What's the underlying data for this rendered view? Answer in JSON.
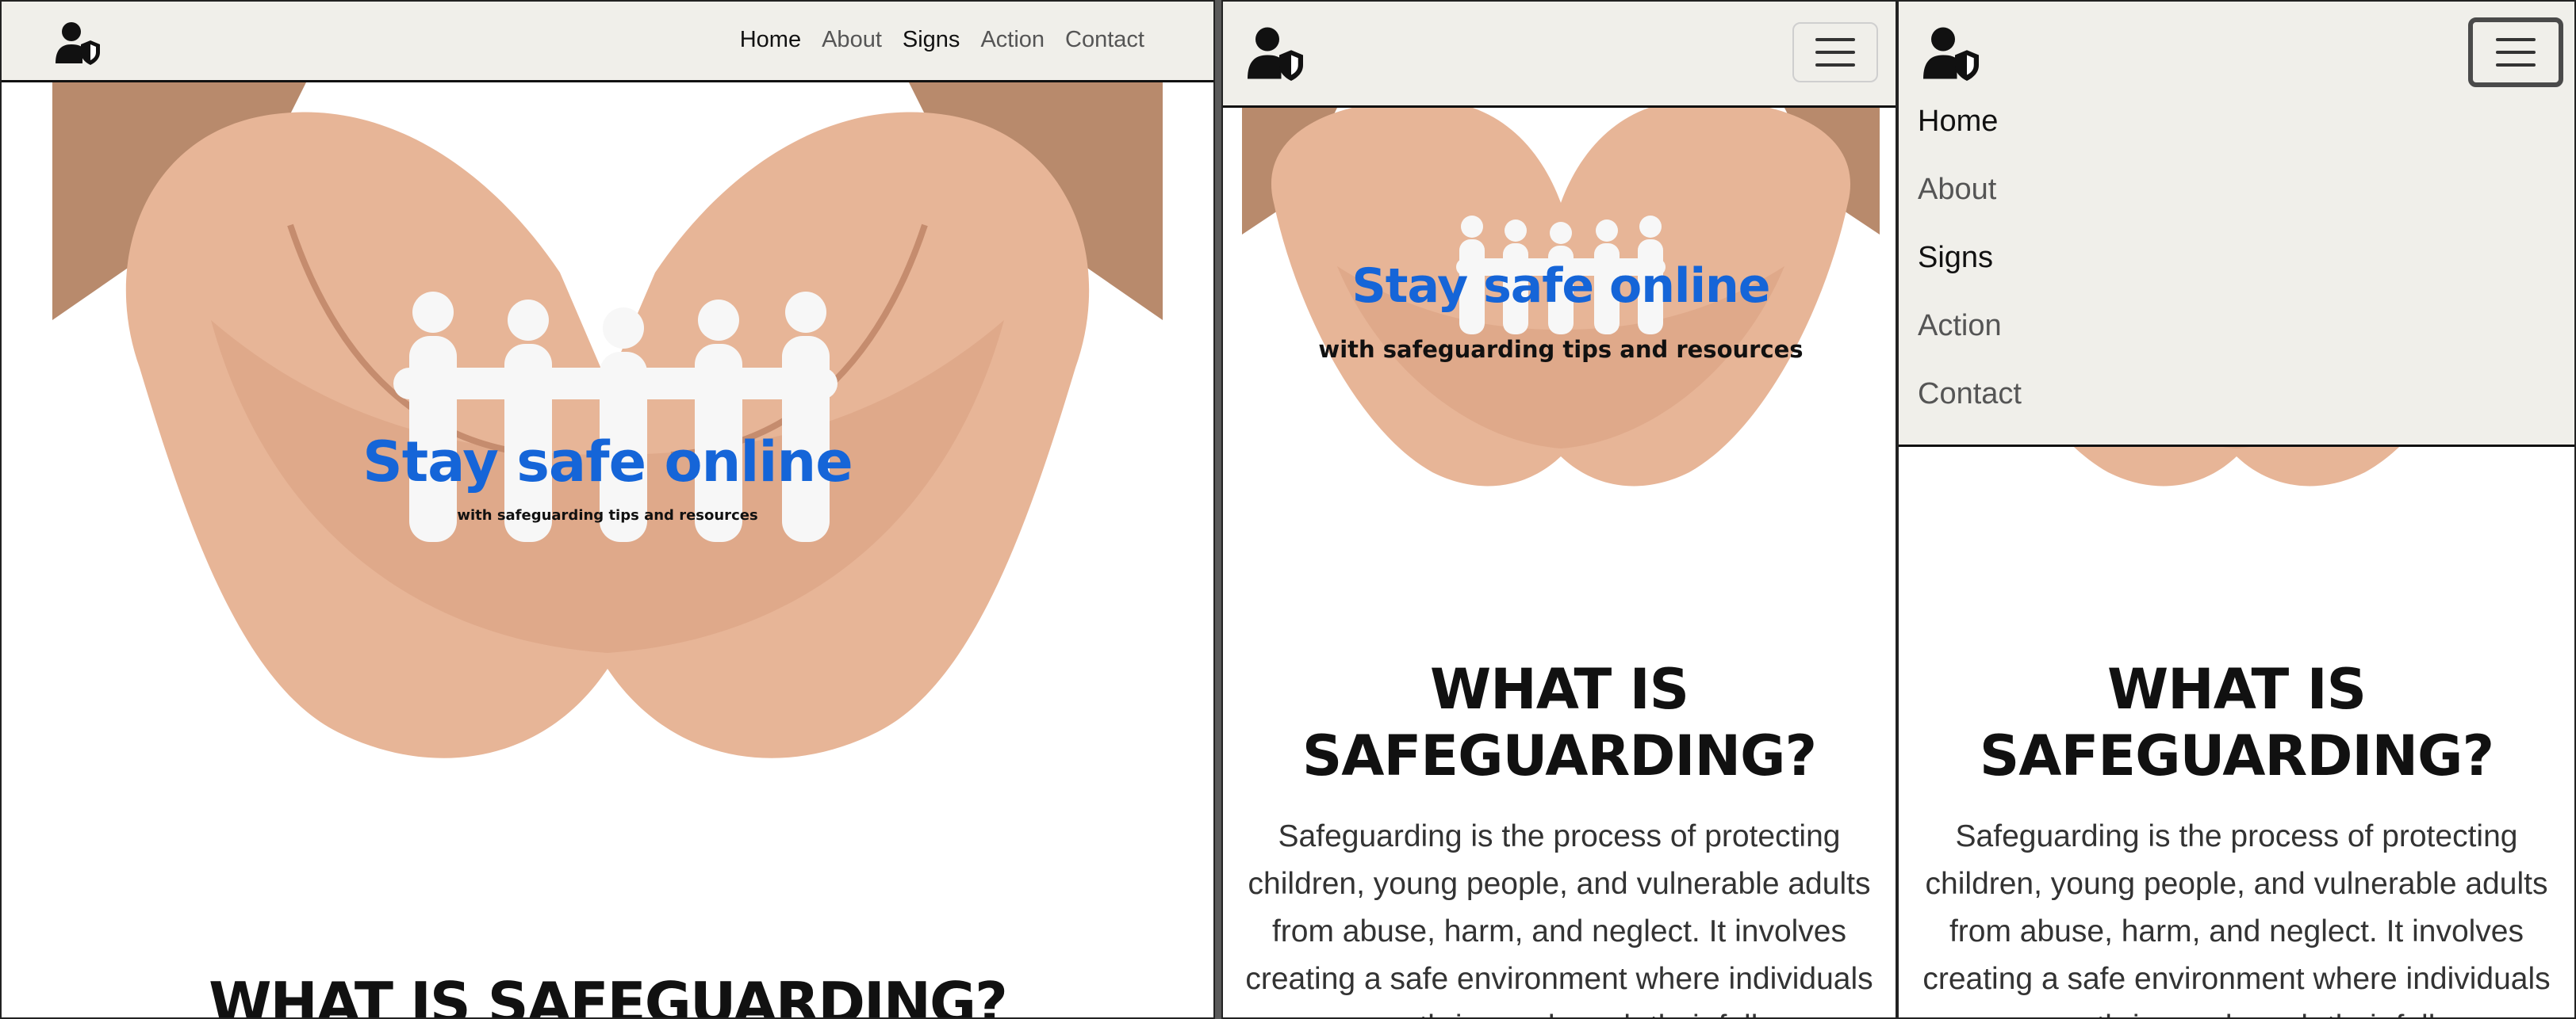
{
  "site": {
    "nav": {
      "items": [
        "Home",
        "About",
        "Signs",
        "Action",
        "Contact"
      ]
    },
    "icons": {
      "logo": "user-shield-icon",
      "menu": "hamburger-icon"
    },
    "hero": {
      "title": "Stay safe online",
      "subtitle": "with safeguarding tips and resources"
    },
    "section": {
      "title": "WHAT IS SAFEGUARDING?",
      "text": "Safeguarding is the process of protecting children, young people, and vulnerable adults from abuse, harm, and neglect. It involves creating a safe environment where individuals can thrive and reach their full"
    },
    "colors": {
      "navbar_bg": "#f0efea",
      "hero_title": "#1565d8",
      "text": "#333333"
    }
  }
}
